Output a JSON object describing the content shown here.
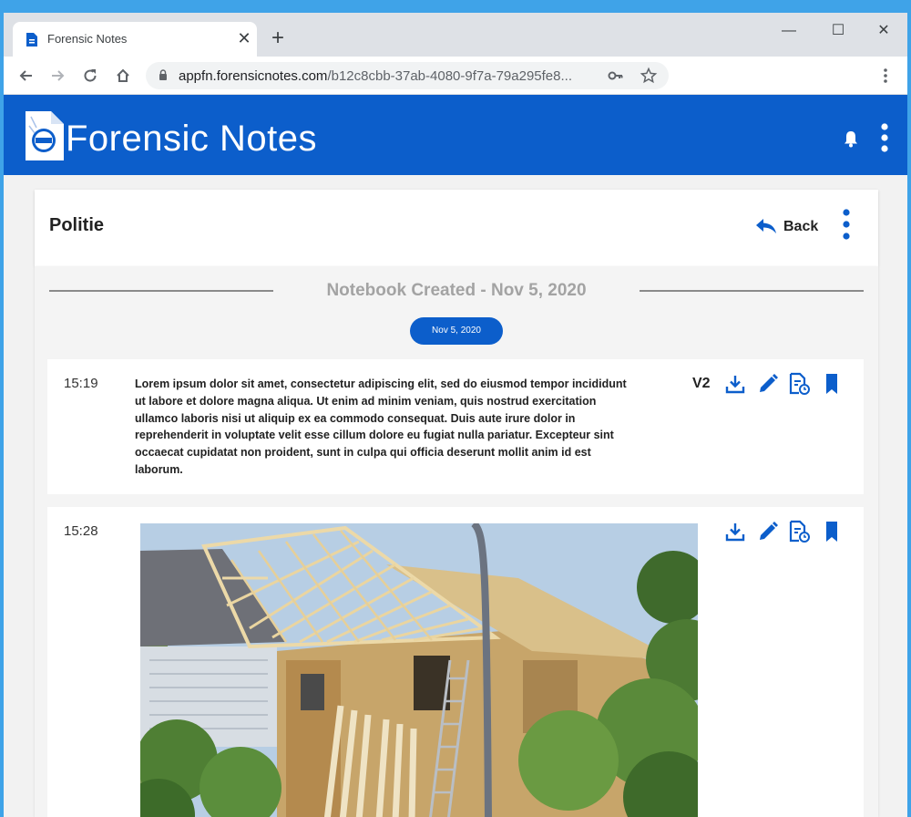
{
  "browser": {
    "tab_title": "Forensic Notes",
    "tab_close": "✕",
    "new_tab": "+",
    "url_host": "appfn.forensicnotes.com",
    "url_path": "/b12c8cbb-37ab-4080-9f7a-79a295fe8...",
    "window_minimize": "—",
    "window_maximize": "☐",
    "window_close": "✕"
  },
  "app": {
    "name": "Forensic Notes"
  },
  "notebook": {
    "title": "Politie",
    "back_label": "Back",
    "created_label": "Notebook Created - Nov 5, 2020",
    "date_pill": "Nov 5, 2020"
  },
  "entries": [
    {
      "time": "15:19",
      "version": "V2",
      "text": "Lorem ipsum dolor sit amet, consectetur adipiscing elit, sed do eiusmod tempor incididunt ut labore et dolore magna aliqua. Ut enim ad minim veniam, quis nostrud exercitation ullamco laboris nisi ut aliquip ex ea commodo consequat. Duis aute irure dolor in reprehenderit in voluptate velit esse cillum dolore eu fugiat nulla pariatur. Excepteur sint occaecat cupidatat non proident, sunt in culpa qui officia deserunt mollit anim id est laborum."
    },
    {
      "time": "15:28"
    }
  ],
  "colors": {
    "brand_blue": "#0c5ecb",
    "desktop": "#3fa3e8"
  }
}
